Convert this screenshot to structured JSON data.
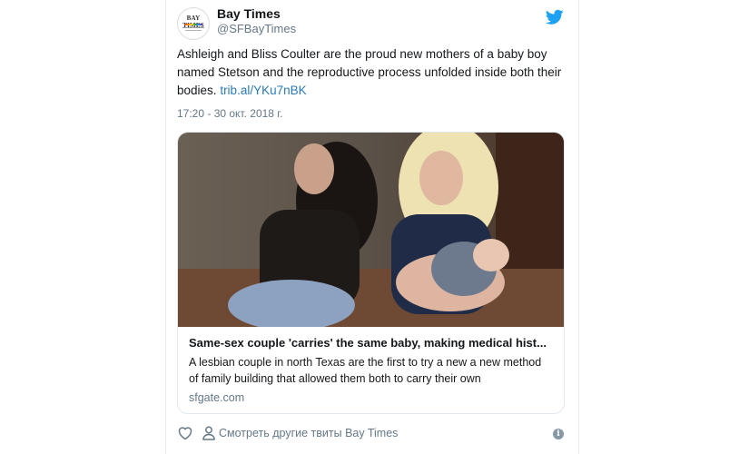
{
  "tweet": {
    "account": {
      "display_name": "Bay Times",
      "handle": "@SFBayTimes",
      "avatar_text": "BAY TIMES"
    },
    "text": "Ashleigh and Bliss Coulter are the proud new mothers of a baby boy named Stetson and the reproductive process unfolded inside both their bodies.",
    "link_text": "trib.al/YKu7nBK",
    "timestamp": "17:20 - 30 окт. 2018 г.",
    "link_card": {
      "title": "Same-sex couple 'carries' the same baby, making medical hist...",
      "description": "A lesbian couple in north Texas are the first to try a new a new method of family building that allowed them both to carry their own",
      "domain": "sfgate.com"
    },
    "footer": {
      "more_tweets_label": "Смотреть другие твиты Bay Times"
    }
  },
  "colors": {
    "twitter_blue": "#1da1f2",
    "link_blue": "#2b7bb9",
    "secondary_text": "#657786"
  },
  "icons": [
    "twitter-bird-icon",
    "heart-icon",
    "person-icon",
    "info-icon"
  ]
}
